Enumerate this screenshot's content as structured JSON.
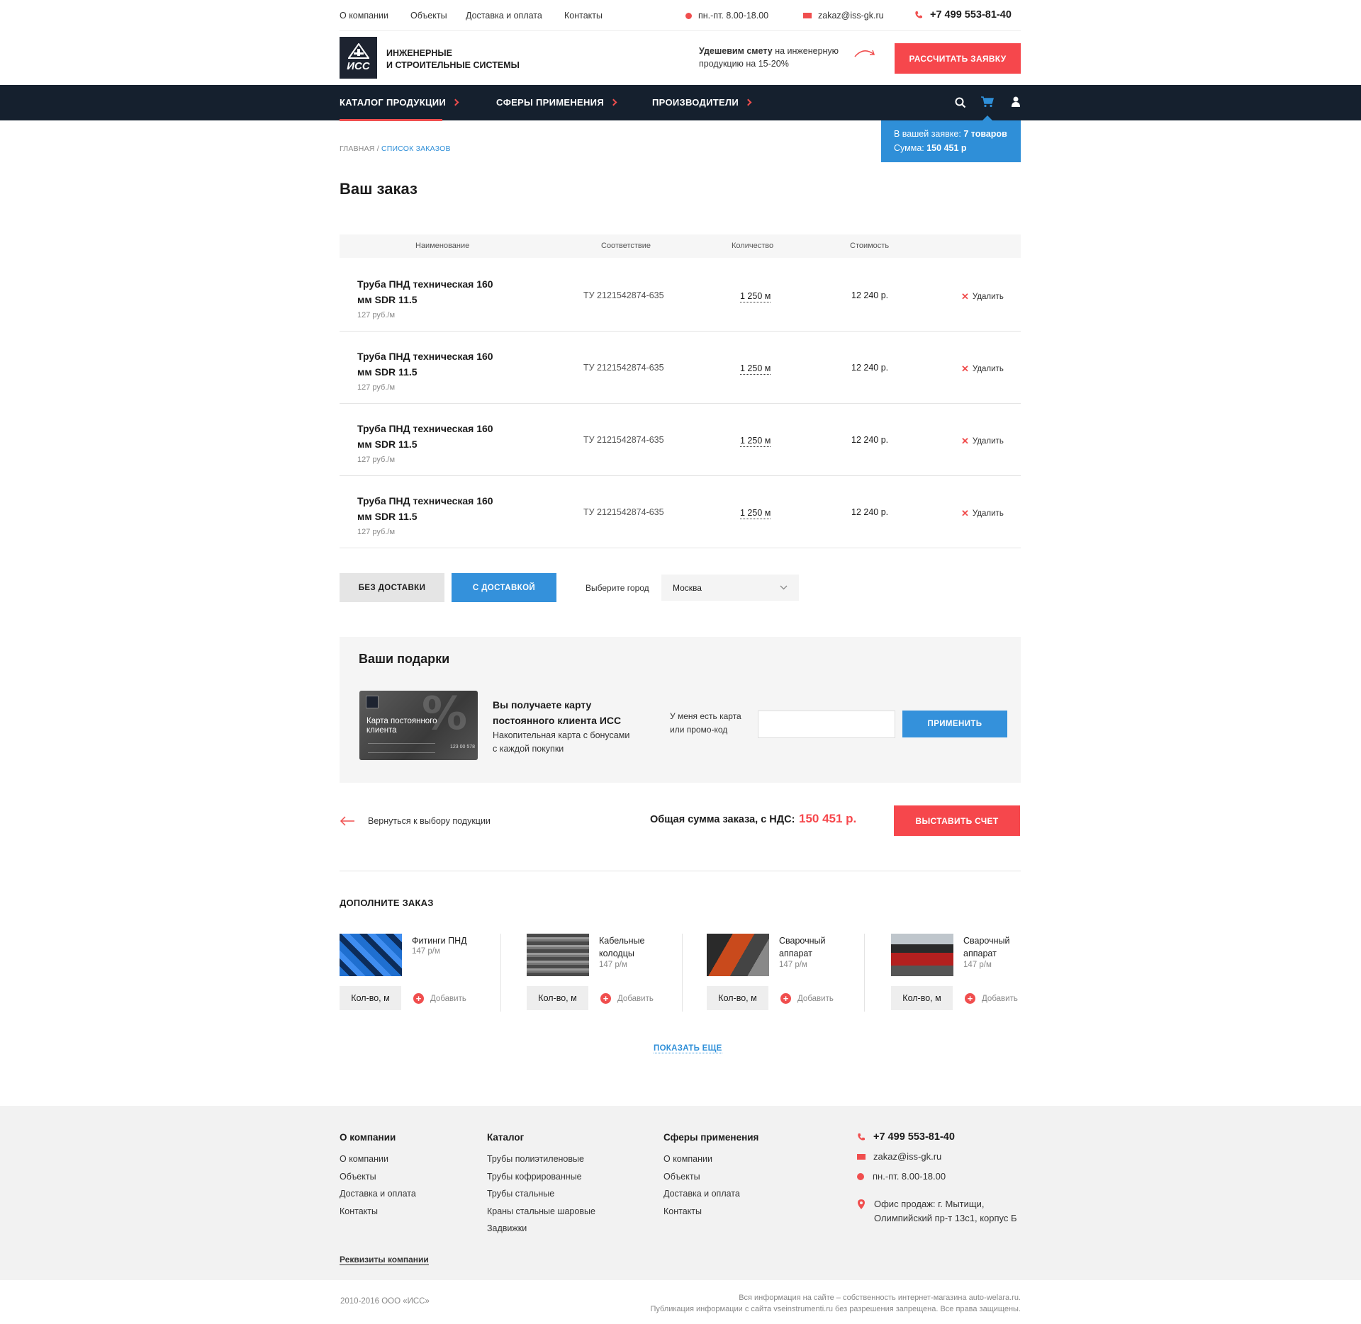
{
  "topbar": {
    "links": [
      "О компании",
      "Объекты",
      "Доставка и оплата",
      "Контакты"
    ],
    "hours": "пн.-пт. 8.00-18.00",
    "email": "zakaz@iss-gk.ru",
    "phone": "+7 499 553-81-40"
  },
  "header": {
    "logo_mark": "ИСС",
    "logo_line1": "ИНЖЕНЕРНЫЕ",
    "logo_line2": "И СТРОИТЕЛЬНЫЕ СИСТЕМЫ",
    "promo_bold": "Удешевим смету",
    "promo_rest1": " на инженерную",
    "promo_line2": "продукцию на 15-20%",
    "cta": "РАССЧИТАТЬ ЗАЯВКУ"
  },
  "nav": {
    "items": [
      "КАТАЛОГ ПРОДУКЦИИ",
      "СФЕРЫ ПРИМЕНЕНИЯ",
      "ПРОИЗВОДИТЕЛИ"
    ],
    "icons": [
      "search-icon",
      "cart-icon",
      "user-icon"
    ]
  },
  "cart_popup": {
    "line1_label": "В вашей заявке: ",
    "line1_value": "7 товаров",
    "line2_label": "Сумма: ",
    "line2_value": "150 451 р"
  },
  "breadcrumb": {
    "home": "ГЛАВНАЯ",
    "sep": " / ",
    "current": "СПИСОК ЗАКАЗОВ"
  },
  "page_title": "Ваш заказ",
  "table": {
    "headers": [
      "Наименование",
      "Соответствие",
      "Количество",
      "Стоимость"
    ],
    "rows": [
      {
        "name": "Труба ПНД техническая 160 мм SDR 11.5",
        "price": "127 руб./м",
        "spec": "ТУ 2121542874-635",
        "qty": "1 250 м",
        "cost": "12 240 р.",
        "delete": "Удалить"
      },
      {
        "name": "Труба ПНД техническая 160 мм SDR 11.5",
        "price": "127 руб./м",
        "spec": "ТУ 2121542874-635",
        "qty": "1 250 м",
        "cost": "12 240 р.",
        "delete": "Удалить"
      },
      {
        "name": "Труба ПНД техническая 160 мм SDR 11.5",
        "price": "127 руб./м",
        "spec": "ТУ 2121542874-635",
        "qty": "1 250 м",
        "cost": "12 240 р.",
        "delete": "Удалить"
      },
      {
        "name": "Труба ПНД техническая 160 мм SDR 11.5",
        "price": "127 руб./м",
        "spec": "ТУ 2121542874-635",
        "qty": "1 250 м",
        "cost": "12 240 р.",
        "delete": "Удалить"
      }
    ]
  },
  "delivery": {
    "no_delivery": "БЕЗ ДОСТАВКИ",
    "with_delivery": "С ДОСТАВКОЙ",
    "city_label": "Выберите город",
    "city_value": "Москва"
  },
  "gifts": {
    "title": "Ваши подарки",
    "card_label_1": "Карта постоянного",
    "card_label_2": "клиента",
    "card_number": "123 00 578",
    "offer_title_1": "Вы получаете карту",
    "offer_title_2": "постоянного клиента ИСС",
    "offer_desc_1": "Накопительная карта с бонусами",
    "offer_desc_2": "с каждой покупки",
    "promo_label_1": "У меня есть карта",
    "promo_label_2": "или промо-код",
    "promo_placeholder": "",
    "apply": "ПРИМЕНИТЬ"
  },
  "summary": {
    "back": "Вернуться к выбору подукции",
    "total_label": "Общая сумма заказа, с НДС:",
    "total_value": "150 451 р.",
    "invoice": "ВЫСТАВИТЬ СЧЕТ"
  },
  "extras": {
    "title": "ДОПОЛНИТЕ ЗАКАЗ",
    "products": [
      {
        "name": "Фитинги ПНД",
        "price": "147 р/м",
        "qty": "Кол-во, м",
        "add": "Добавить"
      },
      {
        "name": "Кабельные колодцы",
        "price": "147 р/м",
        "qty": "Кол-во, м",
        "add": "Добавить"
      },
      {
        "name": "Сварочный аппарат",
        "price": "147 р/м",
        "qty": "Кол-во, м",
        "add": "Добавить"
      },
      {
        "name": "Сварочный аппарат",
        "price": "147 р/м",
        "qty": "Кол-во, м",
        "add": "Добавить"
      }
    ],
    "show_more": "ПОКАЗАТЬ ЕЩЕ"
  },
  "footer": {
    "col1": {
      "title": "О компании",
      "items": [
        "О компании",
        "Объекты",
        "Доставка и оплата",
        "Контакты"
      ]
    },
    "col2": {
      "title": "Каталог",
      "items": [
        "Трубы полиэтиленовые",
        "Трубы кофрированные",
        "Трубы стальные",
        "Краны стальные шаровые",
        "Задвижки"
      ]
    },
    "col3": {
      "title": "Сферы применения",
      "items": [
        "О компании",
        "Объекты",
        "Доставка и оплата",
        "Контакты"
      ]
    },
    "requisites": "Реквизиты компании",
    "phone": "+7 499 553-81-40",
    "email": "zakaz@iss-gk.ru",
    "hours": "пн.-пт. 8.00-18.00",
    "address_1": "Офис продаж: г. Мытищи,",
    "address_2": "Олимпийский пр-т 13с1, корпус Б",
    "copyright": "2010-2016 ООО «ИСС»",
    "legal_1": "Вся информация на сайте – собственность интернет-магазина auto-welara.ru.",
    "legal_2": "Публикация информации с сайта vseinstrumenti.ru без разрешения запрещена. Все права защищены."
  },
  "colors": {
    "accent_red": "#f6474c",
    "accent_blue": "#3491db",
    "nav_bg": "#15202e"
  }
}
